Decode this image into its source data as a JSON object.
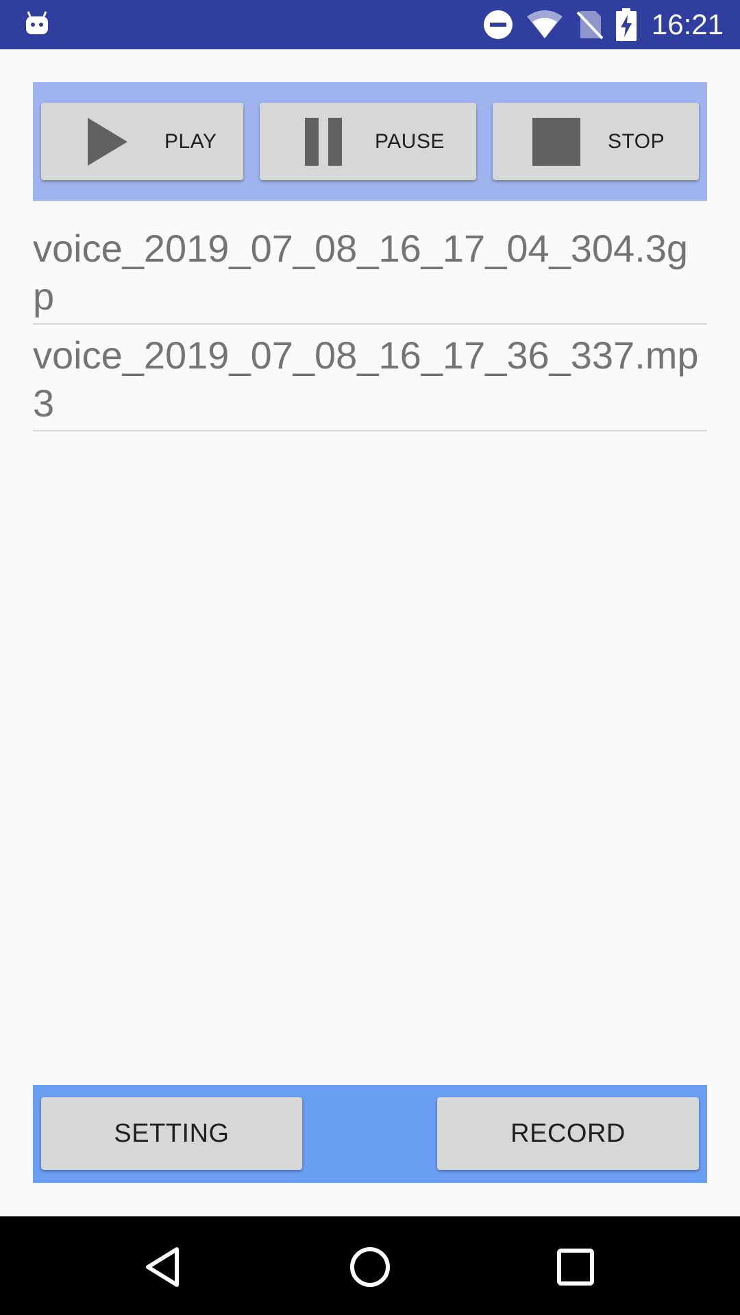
{
  "status_bar": {
    "time": "16:21",
    "icons": [
      "android-notification-icon",
      "do-not-disturb-icon",
      "wifi-icon",
      "no-sim-icon",
      "battery-charging-icon"
    ],
    "background_color": "#303f9f"
  },
  "player_controls": {
    "play_label": "PLAY",
    "pause_label": "PAUSE",
    "stop_label": "STOP",
    "panel_color": "#9fb4ef"
  },
  "files": [
    {
      "name": "voice_2019_07_08_16_17_04_304.3gp"
    },
    {
      "name": "voice_2019_07_08_16_17_36_337.mp3"
    }
  ],
  "bottom_bar": {
    "setting_label": "SETTING",
    "record_label": "RECORD",
    "panel_color": "#6a9ef2"
  },
  "nav_bar": {
    "buttons": [
      "back-icon",
      "home-icon",
      "recents-icon"
    ]
  }
}
